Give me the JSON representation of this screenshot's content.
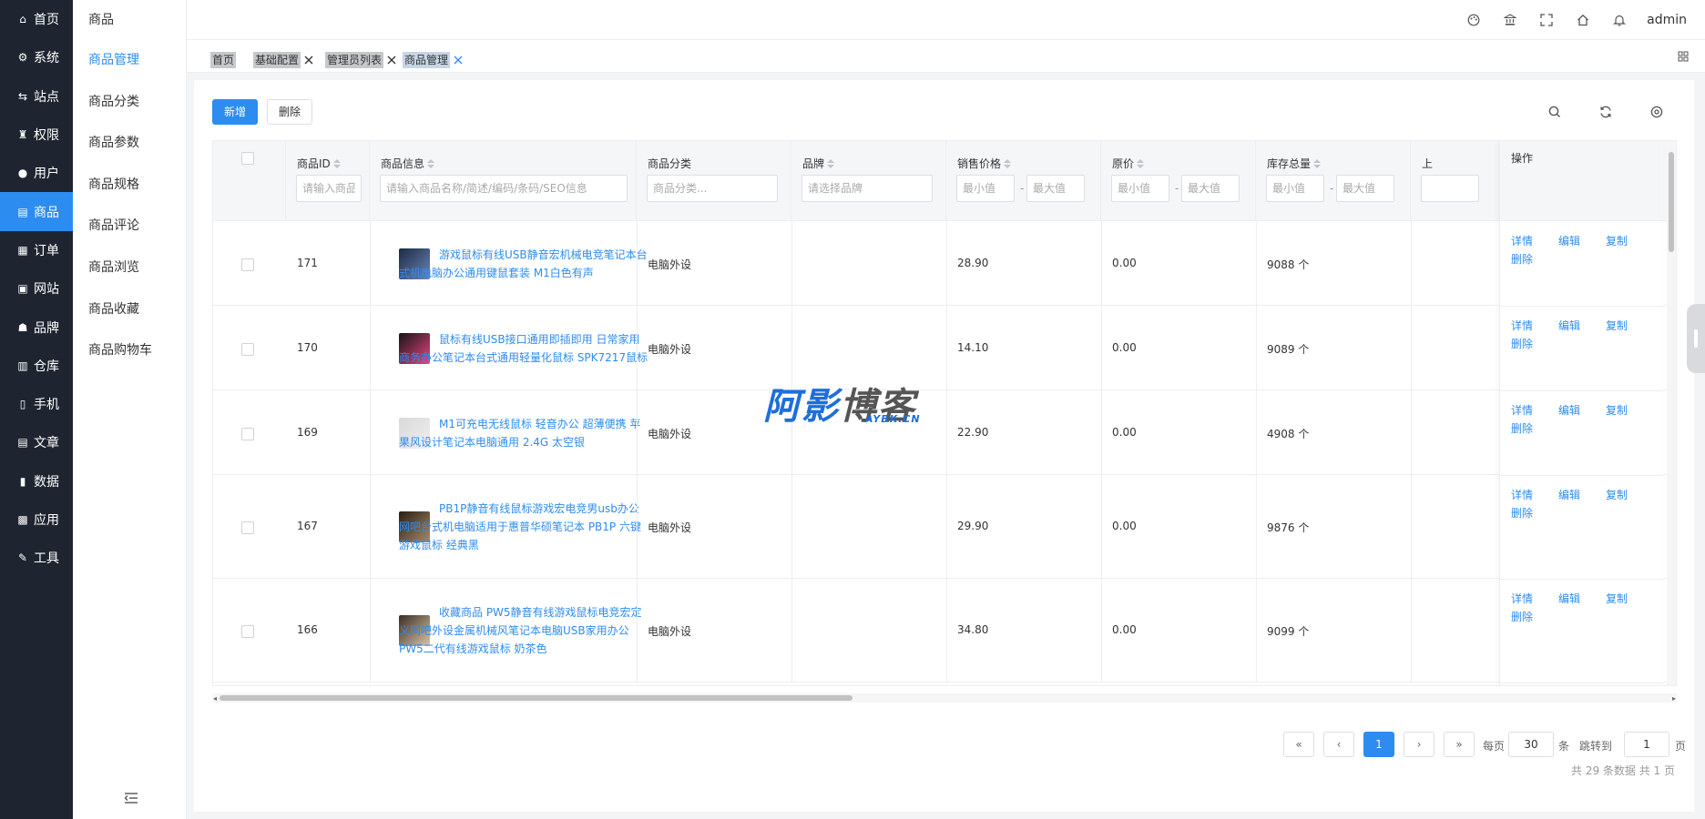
{
  "main_nav": [
    {
      "label": "首页",
      "icon": "home-icon"
    },
    {
      "label": "系统",
      "icon": "gear-icon"
    },
    {
      "label": "站点",
      "icon": "site-icon"
    },
    {
      "label": "权限",
      "icon": "permission-icon"
    },
    {
      "label": "用户",
      "icon": "user-icon"
    },
    {
      "label": "商品",
      "icon": "goods-icon"
    },
    {
      "label": "订单",
      "icon": "order-icon"
    },
    {
      "label": "网站",
      "icon": "website-icon"
    },
    {
      "label": "品牌",
      "icon": "brand-icon"
    },
    {
      "label": "仓库",
      "icon": "warehouse-icon"
    },
    {
      "label": "手机",
      "icon": "mobile-icon"
    },
    {
      "label": "文章",
      "icon": "article-icon"
    },
    {
      "label": "数据",
      "icon": "chart-icon"
    },
    {
      "label": "应用",
      "icon": "apps-icon"
    },
    {
      "label": "工具",
      "icon": "wrench-icon"
    }
  ],
  "main_nav_active": "商品",
  "sub_nav": {
    "title": "商品",
    "items": [
      "商品管理",
      "商品分类",
      "商品参数",
      "商品规格",
      "商品评论",
      "商品浏览",
      "商品收藏",
      "商品购物车"
    ],
    "active": "商品管理"
  },
  "topbar": {
    "icons": [
      "palette-icon",
      "bank-icon",
      "fullscreen-icon",
      "home-icon",
      "bell-icon"
    ],
    "user": "admin"
  },
  "tabs": [
    {
      "label": "首页",
      "closable": false
    },
    {
      "label": "基础配置",
      "closable": true
    },
    {
      "label": "管理员列表",
      "closable": true
    },
    {
      "label": "商品管理",
      "closable": true,
      "active": true
    }
  ],
  "toolbar": {
    "add_label": "新增",
    "delete_label": "删除"
  },
  "table": {
    "columns": {
      "id": "商品ID",
      "info": "商品信息",
      "category": "商品分类",
      "brand": "品牌",
      "price": "销售价格",
      "original_price": "原价",
      "stock": "库存总量",
      "next": "上",
      "ops": "操作"
    },
    "filters": {
      "id_placeholder": "请输入商品ID",
      "info_placeholder": "请输入商品名称/简述/编码/条码/SEO信息",
      "category_placeholder": "商品分类...",
      "brand_placeholder": "请选择品牌",
      "min_placeholder": "最小值",
      "max_placeholder": "最大值",
      "range_sep": "-"
    },
    "rows": [
      {
        "id": "171",
        "title": "游戏鼠标有线USB静音宏机械电竞笔记本台式机电脑办公通用键鼠套装 M1白色有声",
        "category": "电脑外设",
        "brand": "",
        "price": "28.90",
        "original_price": "0.00",
        "stock": "9088 个"
      },
      {
        "id": "170",
        "title": "鼠标有线USB接口通用即插即用 日常家用商务办公笔记本台式通用轻量化鼠标 SPK7217鼠标",
        "category": "电脑外设",
        "brand": "",
        "price": "14.10",
        "original_price": "0.00",
        "stock": "9089 个"
      },
      {
        "id": "169",
        "title": "M1可充电无线鼠标 轻音办公 超薄便携 苹果风设计笔记本电脑通用 2.4G 太空银",
        "category": "电脑外设",
        "brand": "",
        "price": "22.90",
        "original_price": "0.00",
        "stock": "4908 个"
      },
      {
        "id": "167",
        "title": "PB1P静音有线鼠标游戏宏电竞男usb办公网吧台式机电脑适用于惠普华硕笔记本 PB1P 六键游戏鼠标 经典黑",
        "category": "电脑外设",
        "brand": "",
        "price": "29.90",
        "original_price": "0.00",
        "stock": "9876 个"
      },
      {
        "id": "166",
        "title": "收藏商品 PW5静音有线游戏鼠标电竞宏定义网吧外设金属机械风笔记本电脑USB家用办公 PW5二代有线游戏鼠标 奶茶色",
        "category": "电脑外设",
        "brand": "",
        "price": "34.80",
        "original_price": "0.00",
        "stock": "9099 个"
      }
    ],
    "ops": {
      "detail": "详情",
      "edit": "编辑",
      "copy": "复制",
      "delete": "删除"
    }
  },
  "pagination": {
    "first": "«",
    "prev": "‹",
    "current": "1",
    "next": "›",
    "last": "»",
    "per_page_label": "每页",
    "per_page": "30",
    "per_page_unit": "条",
    "jump_label": "跳转到",
    "jump_value": "1",
    "jump_unit": "页",
    "summary": "共 29 条数据  共 1 页"
  },
  "watermark": {
    "main": "阿影博客",
    "sub": "AYBK.CN"
  },
  "colors": {
    "primary": "#2d8cf0",
    "sidebar": "#1f2530"
  }
}
